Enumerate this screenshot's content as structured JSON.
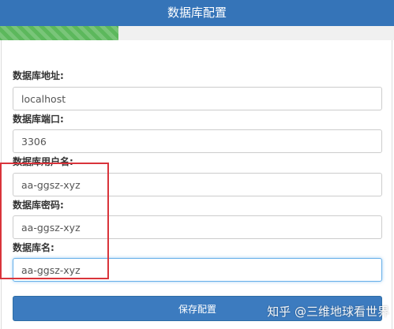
{
  "header": {
    "title": "数据库配置"
  },
  "progress": {
    "value_percent": 30,
    "color": "#5cb85c"
  },
  "form": {
    "fields": [
      {
        "label": "数据库地址:",
        "value": "localhost"
      },
      {
        "label": "数据库端口:",
        "value": "3306"
      },
      {
        "label": "数据库用户名:",
        "value": "aa-ggsz-xyz"
      },
      {
        "label": "数据库密码:",
        "value": "aa-ggsz-xyz"
      },
      {
        "label": "数据库名:",
        "value": "aa-ggsz-xyz"
      }
    ],
    "save_label": "保存配置"
  },
  "watermark": {
    "text": "知乎 @三维地球看世界"
  },
  "colors": {
    "header_bg": "#3574b8",
    "highlight": "#d9343b",
    "button_bg": "#3c7bbf"
  }
}
